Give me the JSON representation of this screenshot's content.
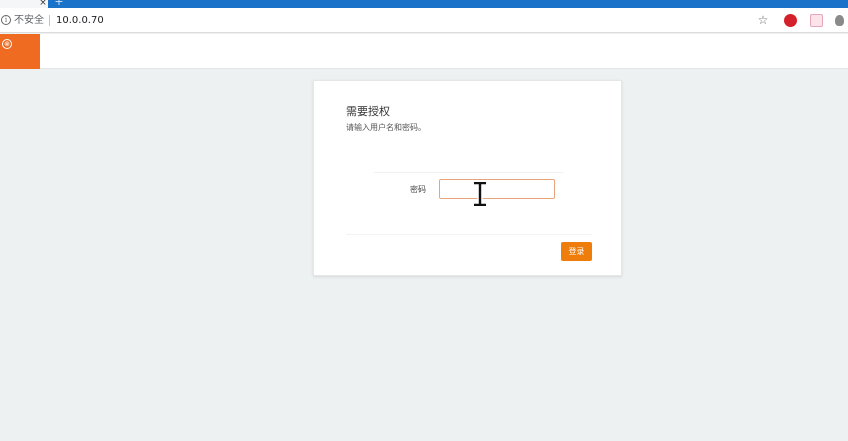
{
  "browser": {
    "tab_close_glyph": "×",
    "new_tab_glyph": "+",
    "security_label": "不安全",
    "url": "10.0.0.70",
    "icons": {
      "info": "info-icon",
      "star": "star-icon",
      "extensions": [
        "red-extension-icon",
        "pink-extension-icon",
        "gray-extension-icon"
      ]
    },
    "colors": {
      "tabstrip": "#1a73c9"
    }
  },
  "header": {
    "brand_glyph": "⊗",
    "brand_color": "#ef6b22"
  },
  "login": {
    "title": "需要授权",
    "subtitle": "请输入用户名和密码。",
    "password_label": "密码",
    "password_value": "",
    "submit_label": "登录",
    "submit_color": "#ef7d0b"
  }
}
